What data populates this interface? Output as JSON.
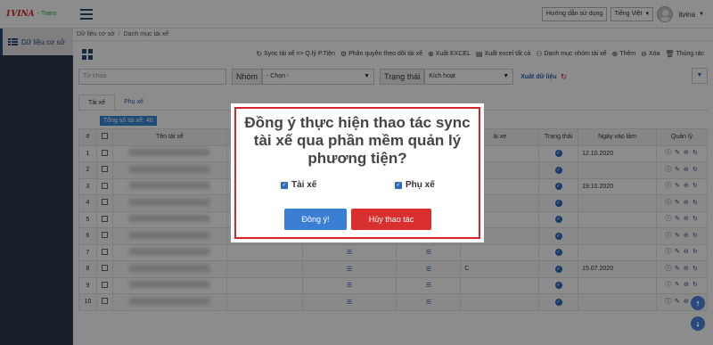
{
  "header": {
    "logo_brand": "1VINA",
    "logo_sub": "- Trans",
    "help_label": "Hướng dẫn sử dụng",
    "language": "Tiếng Việt",
    "username": "itvina"
  },
  "sidebar": {
    "items": [
      {
        "label": "Dữ liệu cơ sở"
      }
    ]
  },
  "breadcrumb": {
    "root": "Dữ liệu cơ sở",
    "current": "Danh mục tài xế"
  },
  "toolbar": {
    "actions": [
      {
        "icon": "sync-icon",
        "label": "Sync tài xế => Q.lý P.Tiện"
      },
      {
        "icon": "gear-icon",
        "label": "Phân quyền theo dõi tài xế"
      },
      {
        "icon": "download-icon",
        "label": "Xuất EXCEL"
      },
      {
        "icon": "file-icon",
        "label": "Xuất excel tất cả"
      },
      {
        "icon": "group-icon",
        "label": "Danh mục nhóm tài xế"
      },
      {
        "icon": "plus-icon",
        "label": "Thêm"
      },
      {
        "icon": "minus-icon",
        "label": "Xóa"
      },
      {
        "icon": "trash-icon",
        "label": "Thùng rác"
      }
    ]
  },
  "filters": {
    "keyword_placeholder": "Từ khóa",
    "group_label": "Nhóm",
    "group_value": "- Chọn -",
    "status_label": "Trạng thái",
    "status_value": "Kích hoạt",
    "export_label": "Xuất dữ liệu"
  },
  "tabs": [
    {
      "label": "Tài xế"
    },
    {
      "label": "Phụ xế"
    }
  ],
  "count_badge": "Tổng số tài xế: 40",
  "table": {
    "headers": [
      "#",
      "",
      "Tên tài xế",
      "",
      "",
      "",
      "ài xe",
      "Trạng thái",
      "Ngày vào làm",
      "Quản lý"
    ],
    "rows": [
      {
        "no": "1",
        "col6": "",
        "date": "12.10.2020"
      },
      {
        "no": "2",
        "col6": "",
        "date": ""
      },
      {
        "no": "3",
        "col6": "",
        "date": "19.10.2020"
      },
      {
        "no": "4",
        "col6": "",
        "date": ""
      },
      {
        "no": "5",
        "col6": "",
        "date": ""
      },
      {
        "no": "6",
        "col6": "",
        "date": ""
      },
      {
        "no": "7",
        "col6": "",
        "date": ""
      },
      {
        "no": "8",
        "col6": "C",
        "date": "15.07.2020"
      },
      {
        "no": "9",
        "col6": "",
        "date": ""
      },
      {
        "no": "10",
        "col6": "",
        "date": ""
      }
    ]
  },
  "modal": {
    "title": "Đồng ý thực hiện thao tác sync tài xế qua phần mềm quản lý phương tiện?",
    "option_driver": "Tài xế",
    "option_assistant": "Phụ xế",
    "confirm_label": "Đồng ý!",
    "cancel_label": "Hủy thao tác"
  },
  "colors": {
    "accent": "#3b7fd4",
    "danger": "#d9302f",
    "nav": "#2a4a7b"
  }
}
